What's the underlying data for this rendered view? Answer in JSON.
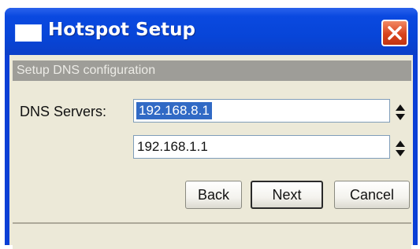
{
  "window": {
    "title": "Hotspot Setup",
    "accent_color": "#0745d8",
    "close_icon": "close-icon",
    "close_color": "#d9431e"
  },
  "section": {
    "header": "Setup DNS configuration"
  },
  "dns": {
    "label": "DNS Servers:",
    "servers": [
      "192.168.8.1",
      "192.168.1.1"
    ],
    "spinner_icon": "up-down-arrows-icon"
  },
  "buttons": {
    "back": "Back",
    "next": "Next",
    "cancel": "Cancel"
  },
  "status": {
    "text": ""
  }
}
